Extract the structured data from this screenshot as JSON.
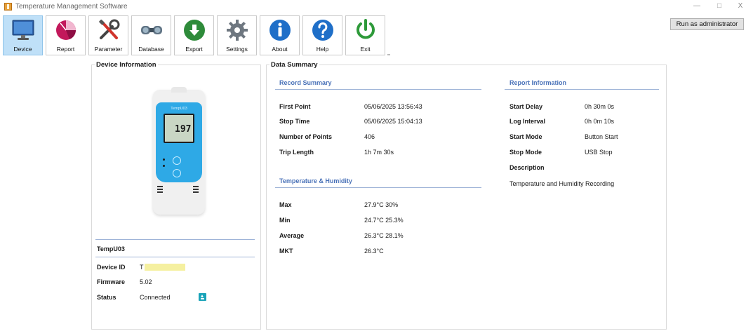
{
  "window": {
    "title": "Temperature Management Software",
    "minimize": "—",
    "maximize": "□",
    "close": "X"
  },
  "toolbar": {
    "items": [
      {
        "label": "Device",
        "icon": "monitor-icon",
        "active": true
      },
      {
        "label": "Report",
        "icon": "pie-chart-icon",
        "active": false
      },
      {
        "label": "Parameter",
        "icon": "tools-icon",
        "active": false
      },
      {
        "label": "Database",
        "icon": "binoculars-icon",
        "active": false
      },
      {
        "label": "Export",
        "icon": "export-arrow-icon",
        "active": false
      },
      {
        "label": "Settings",
        "icon": "gear-icon",
        "active": false
      },
      {
        "label": "About",
        "icon": "info-icon",
        "active": false
      },
      {
        "label": "Help",
        "icon": "help-icon",
        "active": false
      },
      {
        "label": "Exit",
        "icon": "power-icon",
        "active": false
      }
    ],
    "overflow": "‗"
  },
  "run_as_admin": "Run as administrator",
  "device_panel": {
    "title": "Device Information",
    "device_screen_value": "197",
    "device_brand": "TempU03",
    "model": "TempU03",
    "fields": [
      {
        "label": "Device ID",
        "value": "T"
      },
      {
        "label": "Firmware",
        "value": "5.02"
      },
      {
        "label": "Status",
        "value": "Connected"
      }
    ],
    "colors": {
      "device_blue": "#2ea9e6",
      "status_icon": "#19a3b8",
      "redaction": "#f5f0a0"
    }
  },
  "summary_panel": {
    "title": "Data Summary",
    "record_summary": {
      "header": "Record Summary",
      "rows": [
        {
          "label": "First Point",
          "value": "05/06/2025 13:56:43"
        },
        {
          "label": "Stop Time",
          "value": "05/06/2025 15:04:13"
        },
        {
          "label": "Number of Points",
          "value": "406"
        },
        {
          "label": "Trip Length",
          "value": "1h 7m 30s"
        }
      ]
    },
    "temp_humidity": {
      "header": "Temperature & Humidity",
      "rows": [
        {
          "label": "Max",
          "value": "27.9°C  30%"
        },
        {
          "label": "Min",
          "value": "24.7°C  25.3%"
        },
        {
          "label": "Average",
          "value": "26.3°C  28.1%"
        },
        {
          "label": "MKT",
          "value": "26.3°C"
        }
      ]
    },
    "report_info": {
      "header": "Report Information",
      "rows": [
        {
          "label": "Start Delay",
          "value": "0h 30m 0s"
        },
        {
          "label": "Log Interval",
          "value": "0h 0m 10s"
        },
        {
          "label": "Start Mode",
          "value": "Button Start"
        },
        {
          "label": "Stop Mode",
          "value": "USB Stop"
        }
      ],
      "description_label": "Description",
      "description_value": "Temperature and Humidity Recording"
    },
    "colors": {
      "section_header": "#4a72b8",
      "divider": "#9fb4d8"
    }
  }
}
